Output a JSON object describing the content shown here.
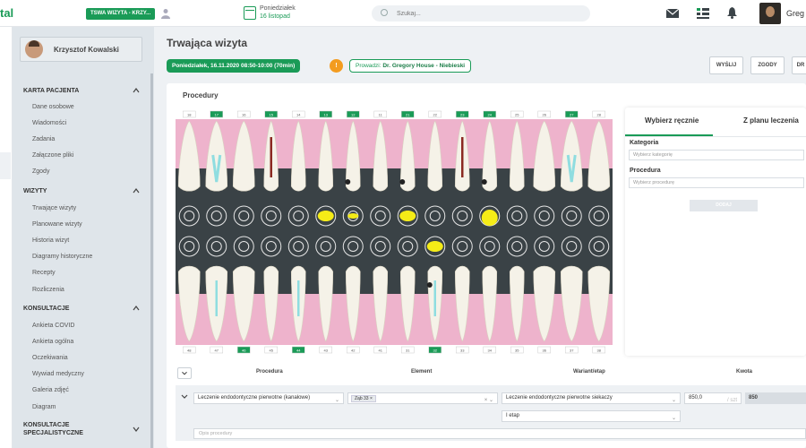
{
  "app": {
    "logo": "tal"
  },
  "topbar": {
    "clinic_badge": "TSWA WIZYTA - KRZY...",
    "date_line1": "Poniedziałek",
    "date_line2": "16 listopad",
    "search_placeholder": "Szukaj...",
    "user_name": "Greg"
  },
  "sidebar": {
    "patient_name": "Krzysztof Kowalski",
    "sections": [
      {
        "title": "KARTA PACJENTA",
        "items": [
          "Dane osobowe",
          "Wiadomości",
          "Zadania",
          "Załączone pliki",
          "Zgody"
        ]
      },
      {
        "title": "WIZYTY",
        "items": [
          "Trwające wizyty",
          "Planowane wizyty",
          "Historia wizyt",
          "Diagramy historyczne",
          "Recepty",
          "Rozliczenia"
        ]
      },
      {
        "title": "KONSULTACJE",
        "items": [
          "Ankieta COVID",
          "Ankieta ogólna",
          "Oczekiwania",
          "Wywiad medyczny",
          "Galeria zdjęć",
          "Diagram"
        ]
      },
      {
        "title": "KONSULTACJE SPECJALISTYCZNE",
        "items": []
      }
    ]
  },
  "main": {
    "title": "Trwająca wizyta",
    "visit_time": "Poniedziałek, 16.11.2020 08:50-10:00 (70min)",
    "info_badge": "!",
    "doctor_prefix": "Prowadzi:",
    "doctor_name": "Dr. Gregory House - Niebieski",
    "buttons": [
      "WYŚLIJ",
      "ZGODY",
      "DR"
    ],
    "card_title": "Procedury"
  },
  "dental_chart": {
    "upper_numbers": [
      "18",
      "17",
      "16",
      "15",
      "14",
      "13",
      "12",
      "11",
      "21",
      "22",
      "23",
      "24",
      "25",
      "26",
      "27",
      "28"
    ],
    "lower_numbers": [
      "48",
      "47",
      "46",
      "45",
      "44",
      "43",
      "42",
      "41",
      "31",
      "32",
      "33",
      "34",
      "35",
      "36",
      "37",
      "38"
    ],
    "highlighted_upper": [
      "17",
      "15",
      "13",
      "12",
      "21",
      "23",
      "24",
      "27"
    ],
    "highlighted_lower": [
      "46",
      "44",
      "32"
    ],
    "colors": {
      "gum": "#eeb3cc",
      "panel": "#3a4246",
      "accent": "#1a9b57",
      "marked": "#f5ec17",
      "canal": "#8fdde0"
    }
  },
  "procedure_panel": {
    "tabs": [
      "Wybierz ręcznie",
      "Z planu leczenia"
    ],
    "category_label": "Kategoria",
    "category_placeholder": "Wybierz kategorię",
    "procedure_label": "Procedura",
    "procedure_placeholder": "Wybierz procedurę",
    "add_button": "DODAJ"
  },
  "table": {
    "headers": [
      "Procedura",
      "Element",
      "Wariant/etap",
      "Kwota"
    ],
    "row": {
      "procedure": "Leczenie endodontyczne pierwotne (kanałowe)",
      "element_tag": "Ząb 33",
      "variant": "Leczenie endodontyczne pierwotne siekaczy",
      "amount": "850,0",
      "amount_unit": "/ szt",
      "total": "850",
      "stage": "I etap",
      "description_placeholder": "Opis procedury"
    }
  }
}
